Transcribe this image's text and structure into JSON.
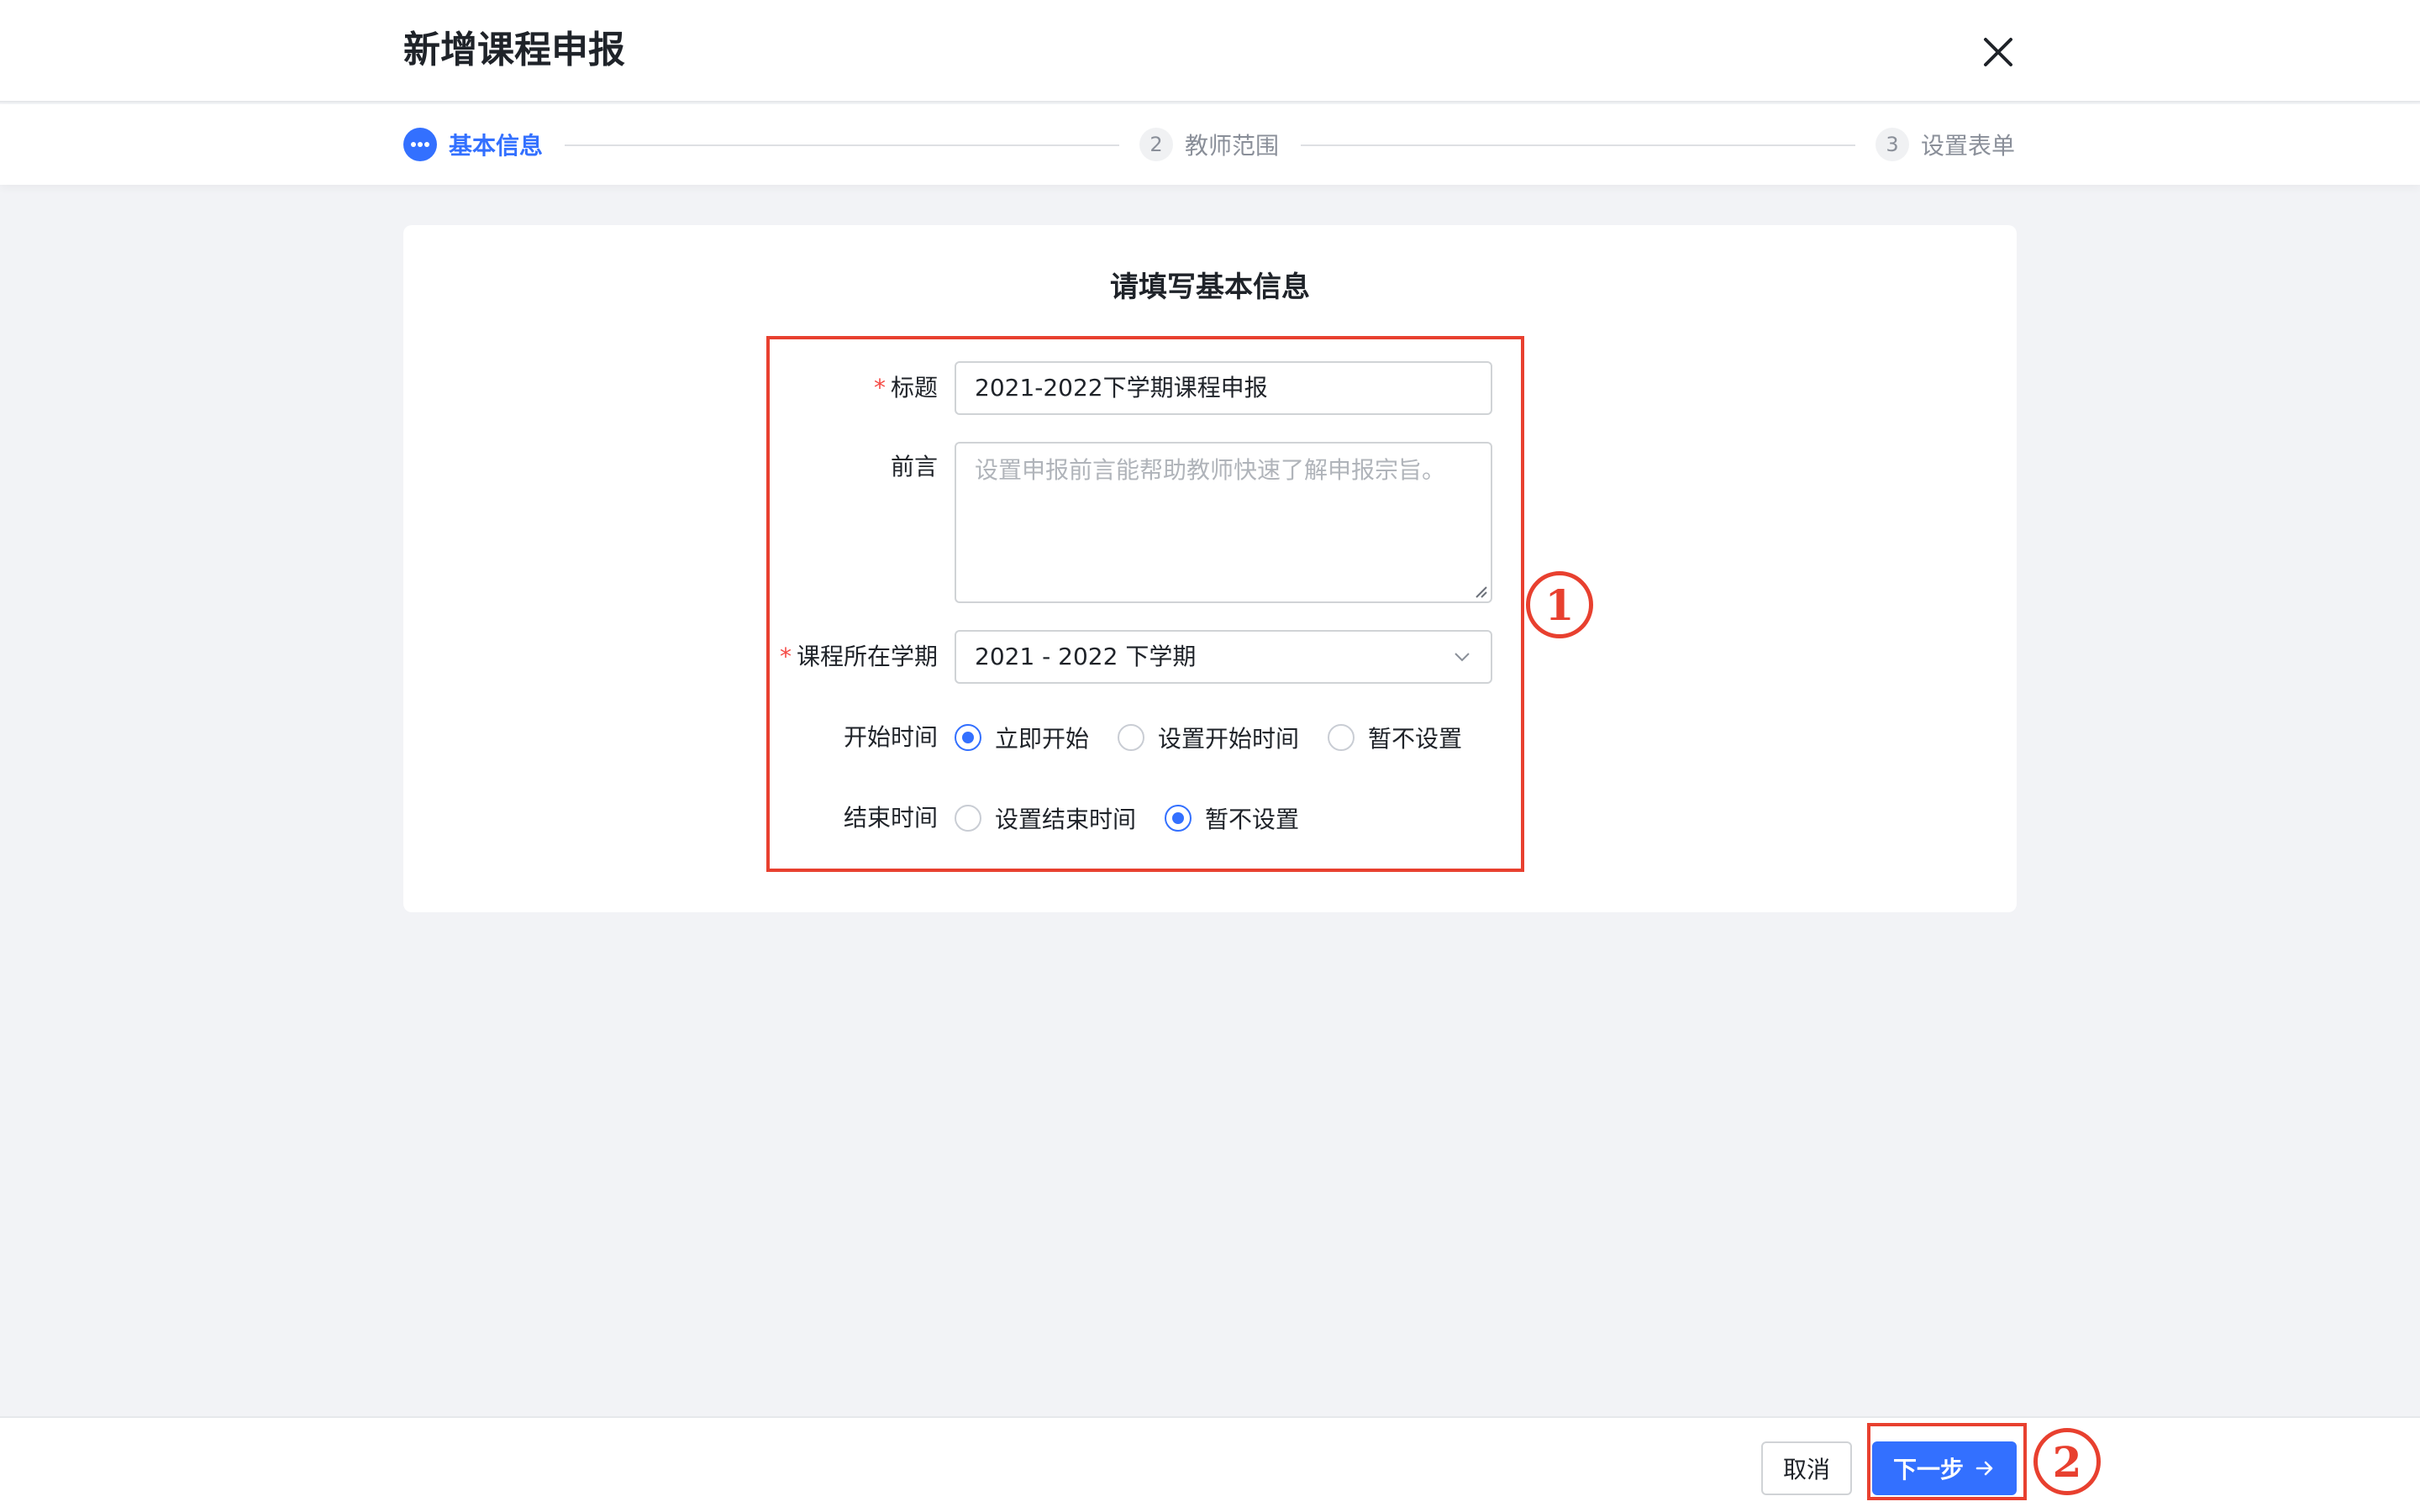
{
  "header": {
    "title": "新增课程申报"
  },
  "steps": [
    {
      "number": "",
      "label": "基本信息",
      "active": true
    },
    {
      "number": "2",
      "label": "教师范围",
      "active": false
    },
    {
      "number": "3",
      "label": "设置表单",
      "active": false
    }
  ],
  "form": {
    "heading": "请填写基本信息",
    "required_mark": "*",
    "title_label": "标题",
    "title_value": "2021-2022下学期课程申报",
    "preface_label": "前言",
    "preface_placeholder": "设置申报前言能帮助教师快速了解申报宗旨。",
    "term_label": "课程所在学期",
    "term_value": "2021 - 2022 下学期",
    "start_label": "开始时间",
    "start_options": [
      "立即开始",
      "设置开始时间",
      "暂不设置"
    ],
    "start_selected": 0,
    "end_label": "结束时间",
    "end_options": [
      "设置结束时间",
      "暂不设置"
    ],
    "end_selected": 1
  },
  "annotations": {
    "one": "1",
    "two": "2",
    "color": "#e8402f"
  },
  "footer": {
    "cancel_label": "取消",
    "next_label": "下一步"
  },
  "colors": {
    "primary": "#3370ff",
    "required": "#f54a45"
  }
}
